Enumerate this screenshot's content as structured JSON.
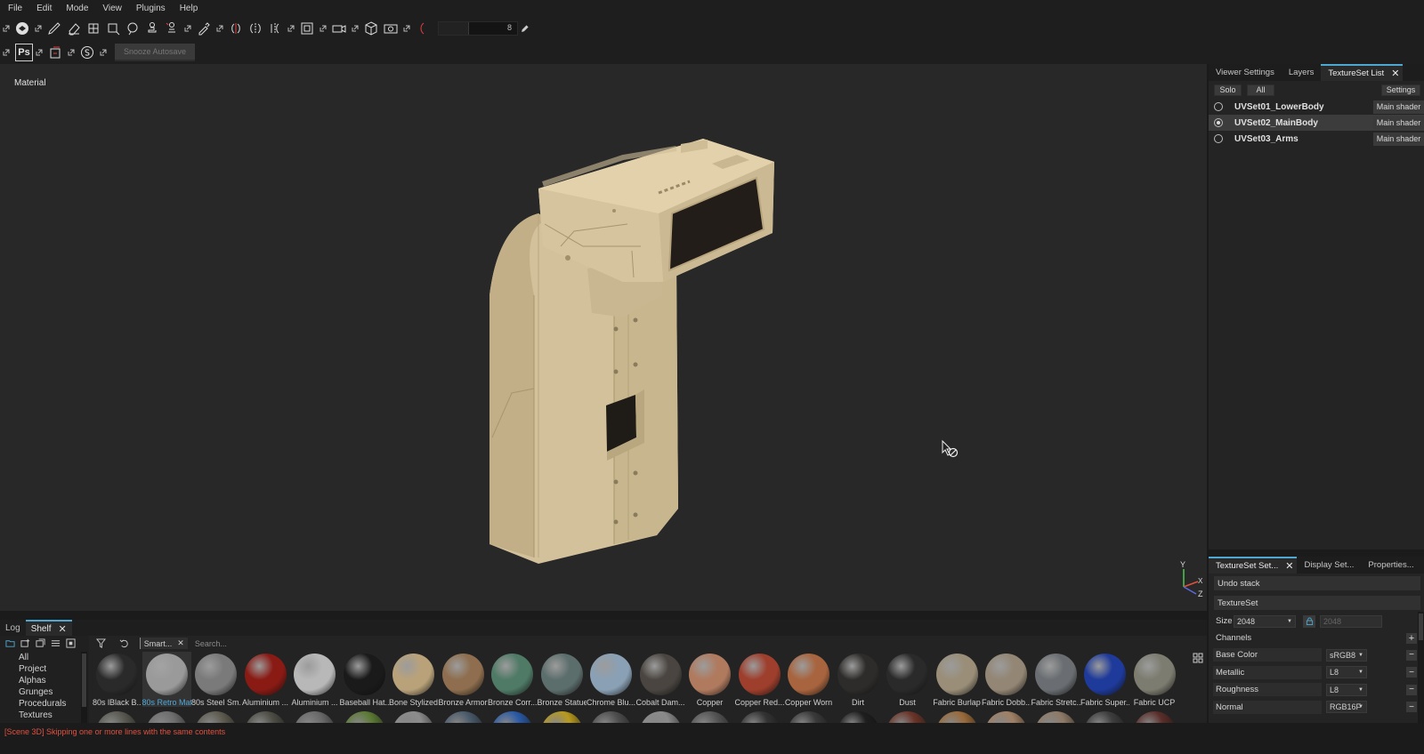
{
  "menu": [
    "File",
    "Edit",
    "Mode",
    "View",
    "Plugins",
    "Help"
  ],
  "toolbar": {
    "brush_size_value": "8",
    "snooze_autosave_label": "Snooze Autosave",
    "ps_label": "Ps"
  },
  "viewport": {
    "mode_label": "Material",
    "axis": {
      "y": "Y",
      "x": "X",
      "z": "Z"
    }
  },
  "dock_tabs": [
    {
      "label": "Log"
    },
    {
      "label": "Shelf"
    }
  ],
  "shelf": {
    "categories": [
      "All",
      "Project",
      "Alphas",
      "Grunges",
      "Procedurals",
      "Textures"
    ],
    "filter_chip": "Smart...",
    "search_placeholder": "Search...",
    "materials": [
      {
        "name": "80s lBlack B...",
        "color": "#2a2a2a"
      },
      {
        "name": "80s Retro Mat",
        "color": "#9a9a9a"
      },
      {
        "name": "80s Steel Sm...",
        "color": "#7a7a7a"
      },
      {
        "name": "Aluminium ...",
        "color": "#8a1a14"
      },
      {
        "name": "Aluminium ...",
        "color": "#b8b8b8"
      },
      {
        "name": "Baseball Hat...",
        "color": "#1a1a1a"
      },
      {
        "name": "Bone Stylized",
        "color": "#b9a27a"
      },
      {
        "name": "Bronze Armor",
        "color": "#8e6e4e"
      },
      {
        "name": "Bronze Corr...",
        "color": "#4f7a66"
      },
      {
        "name": "Bronze Statue",
        "color": "#5c6e6c"
      },
      {
        "name": "Chrome Blu...",
        "color": "#8aa0b4"
      },
      {
        "name": "Cobalt Dam...",
        "color": "#4a4540"
      },
      {
        "name": "Copper",
        "color": "#b07a5e"
      },
      {
        "name": "Copper Red...",
        "color": "#9e3e2c"
      },
      {
        "name": "Copper Worn",
        "color": "#a8643e"
      },
      {
        "name": "Dirt",
        "color": "#2e2c2a"
      },
      {
        "name": "Dust",
        "color": "#2a2a2a"
      },
      {
        "name": "Fabric Burlap",
        "color": "#9a8e78"
      },
      {
        "name": "Fabric Dobb...",
        "color": "#938674"
      },
      {
        "name": "Fabric Stretc...",
        "color": "#6a6e72"
      },
      {
        "name": "Fabric Super...",
        "color": "#1e3a9a"
      },
      {
        "name": "Fabric UCP",
        "color": "#7c7c70"
      }
    ],
    "materials_row2_colors": [
      "#5a5a52",
      "#6e6e6e",
      "#5e5c50",
      "#4e4e46",
      "#6a6a6a",
      "#5c7a34",
      "#8c8c8c",
      "#4a5a6a",
      "#2a5aa6",
      "#b89a1e",
      "#4e4e4e",
      "#8a8a8a",
      "#555555",
      "#333333",
      "#3a3a3a",
      "#1e1e1e",
      "#6a3428",
      "#9a6a3a",
      "#a08064",
      "#8e7a66",
      "#3e3e3e",
      "#5a2e2a"
    ]
  },
  "status": {
    "message": "[Scene 3D] Skipping one or more lines with the same contents"
  },
  "right_top": {
    "tabs": [
      "Viewer Settings",
      "Layers",
      "TextureSet List"
    ],
    "solo_label": "Solo",
    "all_label": "All",
    "settings_label": "Settings",
    "texture_sets": [
      {
        "name": "UVSet01_LowerBody",
        "shader": "Main shader",
        "selected": false
      },
      {
        "name": "UVSet02_MainBody",
        "shader": "Main shader",
        "selected": true
      },
      {
        "name": "UVSet03_Arms",
        "shader": "Main shader",
        "selected": false
      }
    ]
  },
  "right_bottom": {
    "tabs": [
      "TextureSet Set...",
      "Display Set...",
      "Properties..."
    ],
    "undo_stack_label": "Undo stack",
    "textureset_label": "TextureSet",
    "size_label": "Size",
    "size_value": "2048",
    "size_value_locked": "2048",
    "channels_label": "Channels",
    "channels": [
      {
        "name": "Base Color",
        "format": "sRGB8"
      },
      {
        "name": "Metallic",
        "format": "L8"
      },
      {
        "name": "Roughness",
        "format": "L8"
      },
      {
        "name": "Normal",
        "format": "RGB16F"
      }
    ]
  },
  "colors": {
    "accent": "#4fa8d0",
    "model_base": "#d6c49e",
    "status_error": "#e25241"
  }
}
